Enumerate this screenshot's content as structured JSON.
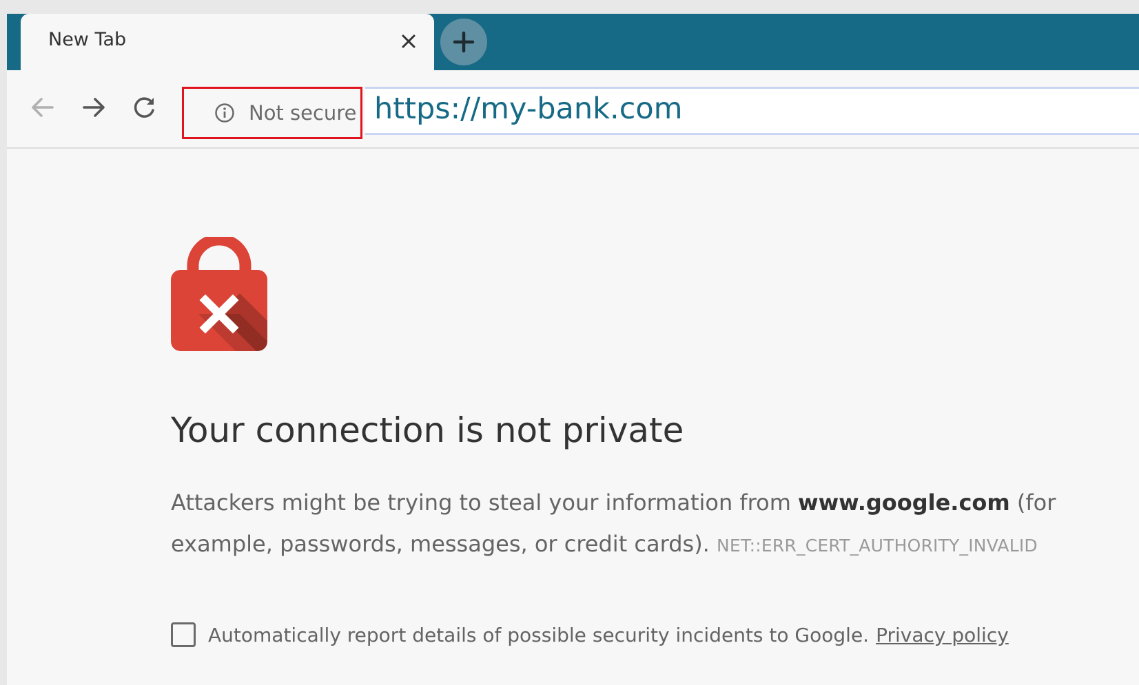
{
  "browser": {
    "tab": {
      "title": "New Tab",
      "close_icon": "close-icon"
    },
    "new_tab_icon": "plus-icon",
    "toolbar": {
      "back_icon": "arrow-left-icon",
      "forward_icon": "arrow-right-icon",
      "reload_icon": "reload-icon",
      "security_icon": "info-icon",
      "security_label": "Not secure",
      "url": "https://my-bank.com"
    }
  },
  "page": {
    "icon": "lock-error-icon",
    "heading": "Your connection is not private",
    "message_prefix": "Attackers might be trying to steal your information from ",
    "message_domain": "www.google.com",
    "message_suffix": " (for example, passwords, messages, or credit cards).",
    "error_code": "NET::ERR_CERT_AUTHORITY_INVALID",
    "report_text": "Automatically report details of possible security incidents to Google.",
    "privacy_link": "Privacy policy",
    "report_checked": false
  },
  "colors": {
    "tabstrip": "#176a86",
    "url_text": "#176a86",
    "lock_red": "#db4437",
    "security_highlight_border": "#e0141e"
  }
}
